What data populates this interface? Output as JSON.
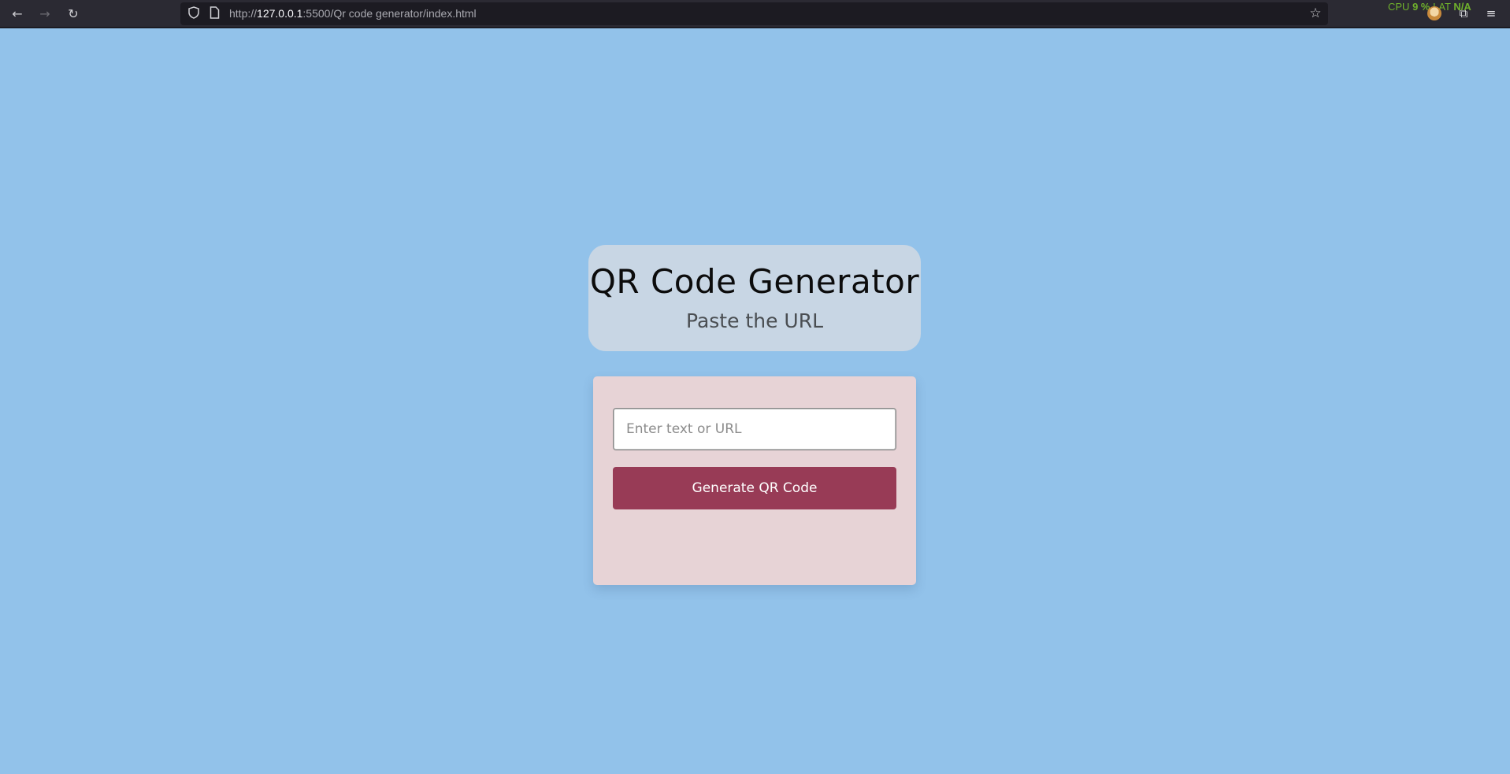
{
  "browser": {
    "back_icon": "←",
    "forward_icon": "→",
    "reload_icon": "↻",
    "url_prefix": "http://",
    "url_host": "127.0.0.1",
    "url_rest": ":5500/Qr code generator/index.html",
    "bookmark_icon": "☆",
    "perf_cpu_label": "CPU",
    "perf_cpu_value": "9 %",
    "perf_lat_label": "LAT",
    "perf_lat_value": "N/A",
    "extensions_icon": "⧉",
    "menu_icon": "≡"
  },
  "header": {
    "title": "QR Code Generator",
    "subtitle": "Paste the URL"
  },
  "form": {
    "input_placeholder": "Enter text or URL",
    "input_value": "",
    "button_label": "Generate QR Code"
  },
  "colors": {
    "page_background": "#92c2ea",
    "header_card": "#c8d6e4",
    "form_card": "#e7d3d6",
    "button": "#983b56"
  }
}
